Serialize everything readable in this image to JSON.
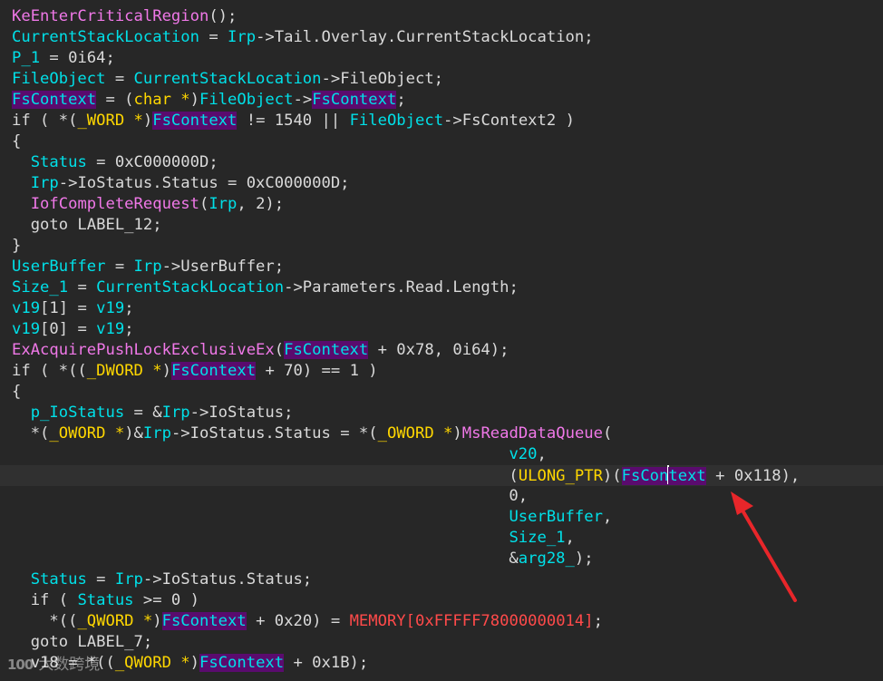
{
  "editor": {
    "lines": [
      {
        "tokens": [
          {
            "t": "KeEnterCriticalRegion",
            "c": "func"
          },
          {
            "t": "();",
            "c": "plain"
          }
        ]
      },
      {
        "tokens": [
          {
            "t": "CurrentStackLocation",
            "c": "var"
          },
          {
            "t": " = ",
            "c": "plain"
          },
          {
            "t": "Irp",
            "c": "var"
          },
          {
            "t": "->Tail.Overlay.CurrentStackLocation;",
            "c": "plain"
          }
        ]
      },
      {
        "tokens": [
          {
            "t": "P_1",
            "c": "var"
          },
          {
            "t": " = 0i64;",
            "c": "plain"
          }
        ]
      },
      {
        "tokens": [
          {
            "t": "FileObject",
            "c": "var"
          },
          {
            "t": " = ",
            "c": "plain"
          },
          {
            "t": "CurrentStackLocation",
            "c": "var"
          },
          {
            "t": "->FileObject;",
            "c": "plain"
          }
        ]
      },
      {
        "tokens": [
          {
            "t": "FsContext",
            "c": "var",
            "hl": true
          },
          {
            "t": " = (",
            "c": "plain"
          },
          {
            "t": "char *",
            "c": "type"
          },
          {
            "t": ")",
            "c": "plain"
          },
          {
            "t": "FileObject",
            "c": "var"
          },
          {
            "t": "->",
            "c": "plain"
          },
          {
            "t": "FsContext",
            "c": "var",
            "hl": true
          },
          {
            "t": ";",
            "c": "plain"
          }
        ]
      },
      {
        "tokens": [
          {
            "t": "if ( *(",
            "c": "plain"
          },
          {
            "t": "_WORD *",
            "c": "type"
          },
          {
            "t": ")",
            "c": "plain"
          },
          {
            "t": "FsContext",
            "c": "var",
            "hl": true
          },
          {
            "t": " != 1540 || ",
            "c": "plain"
          },
          {
            "t": "FileObject",
            "c": "var"
          },
          {
            "t": "->FsContext2 )",
            "c": "plain"
          }
        ]
      },
      {
        "tokens": [
          {
            "t": "{",
            "c": "plain"
          }
        ]
      },
      {
        "tokens": [
          {
            "t": "  ",
            "c": "plain"
          },
          {
            "t": "Status",
            "c": "var"
          },
          {
            "t": " = 0xC000000D;",
            "c": "plain"
          }
        ]
      },
      {
        "tokens": [
          {
            "t": "  ",
            "c": "plain"
          },
          {
            "t": "Irp",
            "c": "var"
          },
          {
            "t": "->IoStatus.Status = 0xC000000D;",
            "c": "plain"
          }
        ]
      },
      {
        "tokens": [
          {
            "t": "  ",
            "c": "plain"
          },
          {
            "t": "IofCompleteRequest",
            "c": "func"
          },
          {
            "t": "(",
            "c": "plain"
          },
          {
            "t": "Irp",
            "c": "var"
          },
          {
            "t": ", 2);",
            "c": "plain"
          }
        ]
      },
      {
        "tokens": [
          {
            "t": "  goto LABEL_12;",
            "c": "plain"
          }
        ]
      },
      {
        "tokens": [
          {
            "t": "}",
            "c": "plain"
          }
        ]
      },
      {
        "tokens": [
          {
            "t": "UserBuffer",
            "c": "var"
          },
          {
            "t": " = ",
            "c": "plain"
          },
          {
            "t": "Irp",
            "c": "var"
          },
          {
            "t": "->UserBuffer;",
            "c": "plain"
          }
        ]
      },
      {
        "tokens": [
          {
            "t": "Size_1",
            "c": "var"
          },
          {
            "t": " = ",
            "c": "plain"
          },
          {
            "t": "CurrentStackLocation",
            "c": "var"
          },
          {
            "t": "->Parameters.Read.Length;",
            "c": "plain"
          }
        ]
      },
      {
        "tokens": [
          {
            "t": "v19",
            "c": "var"
          },
          {
            "t": "[1] = ",
            "c": "plain"
          },
          {
            "t": "v19",
            "c": "var"
          },
          {
            "t": ";",
            "c": "plain"
          }
        ]
      },
      {
        "tokens": [
          {
            "t": "v19",
            "c": "var"
          },
          {
            "t": "[0] = ",
            "c": "plain"
          },
          {
            "t": "v19",
            "c": "var"
          },
          {
            "t": ";",
            "c": "plain"
          }
        ]
      },
      {
        "tokens": [
          {
            "t": "ExAcquirePushLockExclusiveEx",
            "c": "func"
          },
          {
            "t": "(",
            "c": "plain"
          },
          {
            "t": "FsContext",
            "c": "var",
            "hl": true
          },
          {
            "t": " + 0x78, 0i64);",
            "c": "plain"
          }
        ]
      },
      {
        "tokens": [
          {
            "t": "if ( *((",
            "c": "plain"
          },
          {
            "t": "_DWORD *",
            "c": "type"
          },
          {
            "t": ")",
            "c": "plain"
          },
          {
            "t": "FsContext",
            "c": "var",
            "hl": true
          },
          {
            "t": " + 70) == 1 )",
            "c": "plain"
          }
        ]
      },
      {
        "tokens": [
          {
            "t": "{",
            "c": "plain"
          }
        ]
      },
      {
        "tokens": [
          {
            "t": "  ",
            "c": "plain"
          },
          {
            "t": "p_IoStatus",
            "c": "var"
          },
          {
            "t": " = &",
            "c": "plain"
          },
          {
            "t": "Irp",
            "c": "var"
          },
          {
            "t": "->IoStatus;",
            "c": "plain"
          }
        ]
      },
      {
        "tokens": [
          {
            "t": "  *(",
            "c": "plain"
          },
          {
            "t": "_OWORD *",
            "c": "type"
          },
          {
            "t": ")&",
            "c": "plain"
          },
          {
            "t": "Irp",
            "c": "var"
          },
          {
            "t": "->IoStatus.Status = *(",
            "c": "plain"
          },
          {
            "t": "_OWORD *",
            "c": "type"
          },
          {
            "t": ")",
            "c": "plain"
          },
          {
            "t": "MsReadDataQueue",
            "c": "func"
          },
          {
            "t": "(",
            "c": "plain"
          }
        ]
      },
      {
        "tokens": [
          {
            "t": "                                                     ",
            "c": "plain"
          },
          {
            "t": "v20",
            "c": "var"
          },
          {
            "t": ",",
            "c": "plain"
          }
        ]
      },
      {
        "current": true,
        "tokens": [
          {
            "t": "                                                     (",
            "c": "plain"
          },
          {
            "t": "ULONG_PTR",
            "c": "type"
          },
          {
            "t": ")(",
            "c": "plain"
          },
          {
            "t": "FsCon",
            "c": "var",
            "hl": true
          },
          {
            "caret": true
          },
          {
            "t": "text",
            "c": "var",
            "hl": true
          },
          {
            "t": " + 0x118),",
            "c": "plain"
          }
        ]
      },
      {
        "tokens": [
          {
            "t": "                                                     0,",
            "c": "plain"
          }
        ]
      },
      {
        "tokens": [
          {
            "t": "                                                     ",
            "c": "plain"
          },
          {
            "t": "UserBuffer",
            "c": "var"
          },
          {
            "t": ",",
            "c": "plain"
          }
        ]
      },
      {
        "tokens": [
          {
            "t": "                                                     ",
            "c": "plain"
          },
          {
            "t": "Size_1",
            "c": "var"
          },
          {
            "t": ",",
            "c": "plain"
          }
        ]
      },
      {
        "tokens": [
          {
            "t": "                                                     &",
            "c": "plain"
          },
          {
            "t": "arg28_",
            "c": "var"
          },
          {
            "t": ");",
            "c": "plain"
          }
        ]
      },
      {
        "tokens": [
          {
            "t": "  ",
            "c": "plain"
          },
          {
            "t": "Status",
            "c": "var"
          },
          {
            "t": " = ",
            "c": "plain"
          },
          {
            "t": "Irp",
            "c": "var"
          },
          {
            "t": "->IoStatus.Status;",
            "c": "plain"
          }
        ]
      },
      {
        "tokens": [
          {
            "t": "  if ( ",
            "c": "plain"
          },
          {
            "t": "Status",
            "c": "var"
          },
          {
            "t": " >= 0 )",
            "c": "plain"
          }
        ]
      },
      {
        "tokens": [
          {
            "t": "    *((",
            "c": "plain"
          },
          {
            "t": "_QWORD *",
            "c": "type"
          },
          {
            "t": ")",
            "c": "plain"
          },
          {
            "t": "FsContext",
            "c": "var",
            "hl": true
          },
          {
            "t": " + 0x20) = ",
            "c": "plain"
          },
          {
            "t": "MEMORY[0xFFFFF78000000014]",
            "c": "mem"
          },
          {
            "t": ";",
            "c": "plain"
          }
        ]
      },
      {
        "tokens": [
          {
            "t": "  goto LABEL_7;",
            "c": "plain"
          }
        ]
      },
      {
        "tokens": [
          {
            "t": "  v18 = *((",
            "c": "plain"
          },
          {
            "t": "_QWORD *",
            "c": "type"
          },
          {
            "t": ")",
            "c": "plain"
          },
          {
            "t": "FsContext",
            "c": "var",
            "hl": true
          },
          {
            "t": " + 0x1B);",
            "c": "plain"
          }
        ]
      }
    ]
  },
  "annotation": {
    "arrow_color": "#e8262a"
  },
  "watermark": {
    "logo": "100",
    "text": "大数跨境"
  },
  "colors": {
    "background": "#272727",
    "current_line": "#303030",
    "function": "#f078e8",
    "variable": "#00e0e8",
    "type": "#ffd700",
    "highlight": "#5a0b6e",
    "memory": "#ff4a4a",
    "plain": "#dadada"
  }
}
